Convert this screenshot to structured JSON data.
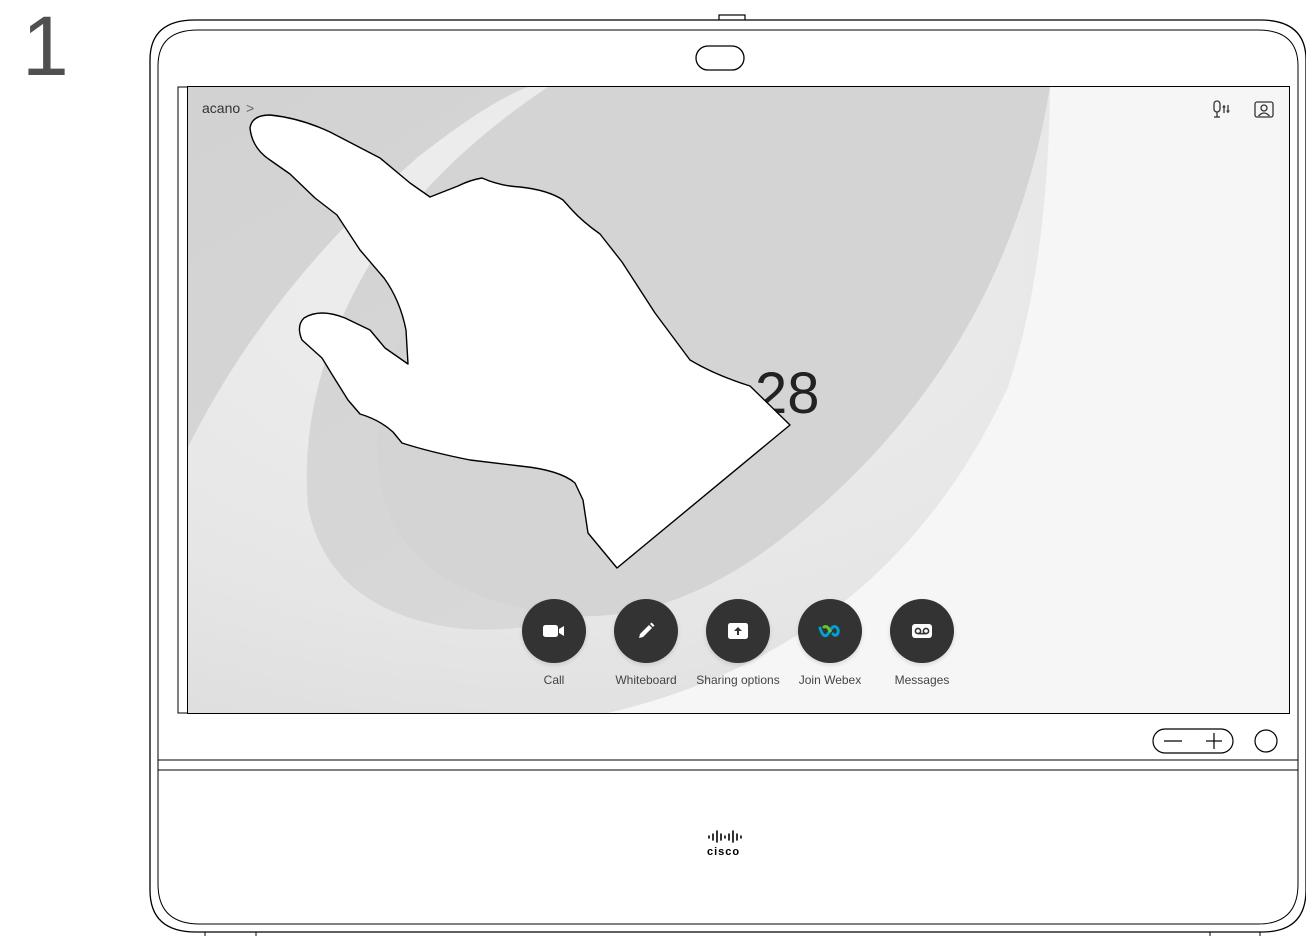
{
  "step": "1",
  "screen": {
    "system_name": "acano",
    "system_chevron": ">",
    "clock": "28",
    "top_icons": [
      "microphone-settings-icon",
      "self-view-icon"
    ],
    "actions": [
      {
        "label": "Call",
        "icon": "video-camera-icon"
      },
      {
        "label": "Whiteboard",
        "icon": "pencil-icon"
      },
      {
        "label": "Sharing options",
        "icon": "share-upload-icon"
      },
      {
        "label": "Join Webex",
        "icon": "webex-logo-icon"
      },
      {
        "label": "Messages",
        "icon": "voicemail-icon"
      }
    ]
  },
  "hardware": {
    "volume_down": "−",
    "volume_up": "+",
    "brand": "cisco"
  },
  "colors": {
    "button_bg": "#333333",
    "webex_blue": "#00a0d1",
    "webex_green": "#67c52f"
  }
}
